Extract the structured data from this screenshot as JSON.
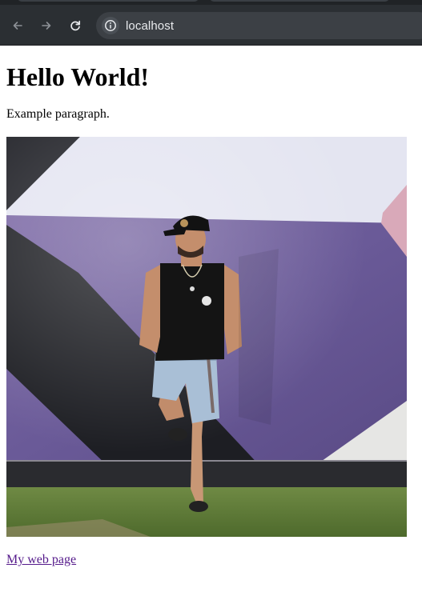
{
  "browser": {
    "url": "localhost",
    "back_icon": "arrow-left-icon",
    "forward_icon": "arrow-right-icon",
    "reload_icon": "reload-icon",
    "site_info_icon": "info-circle-icon"
  },
  "page": {
    "heading": "Hello World!",
    "paragraph": "Example paragraph.",
    "image": {
      "subject": "man in black cap and tank top leaning against a purple and black geometric mural wall, standing on grass"
    },
    "link_text": "My web page"
  },
  "colors": {
    "chrome_bg": "#2b2f33",
    "omnibox_bg": "#3c4045",
    "link_visited": "#551a8b",
    "mural_purple": "#6c5a96",
    "mural_light": "#e3e4f0",
    "mural_dark": "#1c1d22",
    "grass": "#5f7a3a"
  }
}
